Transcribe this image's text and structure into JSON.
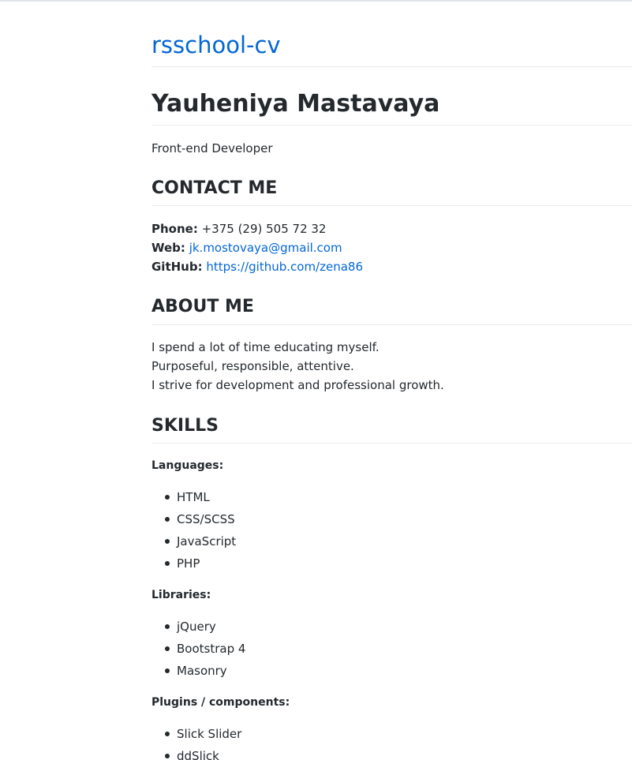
{
  "header": {
    "site_title": "rsschool-cv"
  },
  "profile": {
    "name": "Yauheniya Mastavaya",
    "role": "Front-end Developer"
  },
  "contact": {
    "heading": "CONTACT ME",
    "phone_label": "Phone:",
    "phone_value": "+375 (29) 505 72 32",
    "web_label": "Web:",
    "web_value": "jk.mostovaya@gmail.com",
    "github_label": "GitHub:",
    "github_value": "https://github.com/zena86"
  },
  "about": {
    "heading": "ABOUT ME",
    "lines": [
      "I spend a lot of time educating myself.",
      "Purposeful, responsible, attentive.",
      "I strive for development and professional growth."
    ]
  },
  "skills": {
    "heading": "SKILLS",
    "groups": [
      {
        "label": "Languages:",
        "items": [
          "HTML",
          "CSS/SCSS",
          "JavaScript",
          "PHP"
        ]
      },
      {
        "label": "Libraries:",
        "items": [
          "jQuery",
          "Bootstrap 4",
          "Masonry"
        ]
      },
      {
        "label": "Plugins / components:",
        "items": [
          "Slick Slider",
          "ddSlick"
        ]
      }
    ]
  },
  "colors": {
    "link": "#0366d6",
    "text": "#24292e",
    "rule": "#eaecef"
  }
}
